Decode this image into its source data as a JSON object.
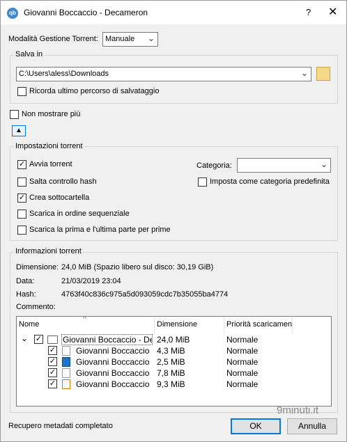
{
  "window": {
    "app_icon_text": "qb",
    "title": "Giovanni Boccaccio - Decameron",
    "help": "?",
    "close": "✕"
  },
  "management": {
    "label": "Modalità Gestione Torrent:",
    "value": "Manuale"
  },
  "save": {
    "group_title": "Salva in",
    "path": "C:\\Users\\aless\\Downloads",
    "remember_label": "Ricorda ultimo percorso di salvataggio",
    "remember_checked": false
  },
  "dont_show": {
    "label": "Non mostrare più",
    "checked": false
  },
  "collapse_symbol": "▲",
  "settings": {
    "group_title": "Impostazioni torrent",
    "start": {
      "label": "Avvia torrent",
      "checked": true
    },
    "skip_hash": {
      "label": "Salta controllo hash",
      "checked": false
    },
    "create_subfolder": {
      "label": "Crea sottocartella",
      "checked": true
    },
    "sequential": {
      "label": "Scarica in ordine sequenziale",
      "checked": false
    },
    "first_last": {
      "label": "Scarica la prima e l'ultima parte per prime",
      "checked": false
    },
    "category_label": "Categoria:",
    "category_value": "",
    "default_category": {
      "label": "Imposta come categoria predefinita",
      "checked": false
    }
  },
  "info": {
    "group_title": "Informazioni torrent",
    "size_label": "Dimensione:",
    "size_value": "24,0 MiB (Spazio libero sul disco: 30,19 GiB)",
    "date_label": "Data:",
    "date_value": "21/03/2019 23:04",
    "hash_label": "Hash:",
    "hash_value": "4763f40c836c975a5d093059cdc7b35055ba4774",
    "comment_label": "Commento:"
  },
  "tree": {
    "sort_indicator": "^",
    "columns": [
      "Nome",
      "Dimensione",
      "Priorità scaricamento"
    ],
    "root": {
      "name": "Giovanni Boccaccio - Decameron",
      "size": "24,0 MiB",
      "priority": "Normale",
      "expand": "⌄"
    },
    "files": [
      {
        "name": "Giovanni Boccaccio - Decameron.txt",
        "size": "4,3 MiB",
        "priority": "Normale",
        "icon": "document-icon"
      },
      {
        "name": "Giovanni Boccaccio - Decameron.epub",
        "size": "2,5 MiB",
        "priority": "Normale",
        "icon": "epub-icon"
      },
      {
        "name": "Giovanni Boccaccio - Decameron.mobi",
        "size": "7,8 MiB",
        "priority": "Normale",
        "icon": "blank-file-icon"
      },
      {
        "name": "Giovanni Boccaccio - Decameron.pdf",
        "size": "9,3 MiB",
        "priority": "Normale",
        "icon": "pdf-icon"
      }
    ]
  },
  "status": "Recupero metadati completato",
  "buttons": {
    "ok": "OK",
    "cancel": "Annulla"
  },
  "watermark": "9minuti.it",
  "colors": {
    "accent": "#0078d7",
    "folder": "#f3d98a",
    "app_icon": "#3f87d4"
  }
}
